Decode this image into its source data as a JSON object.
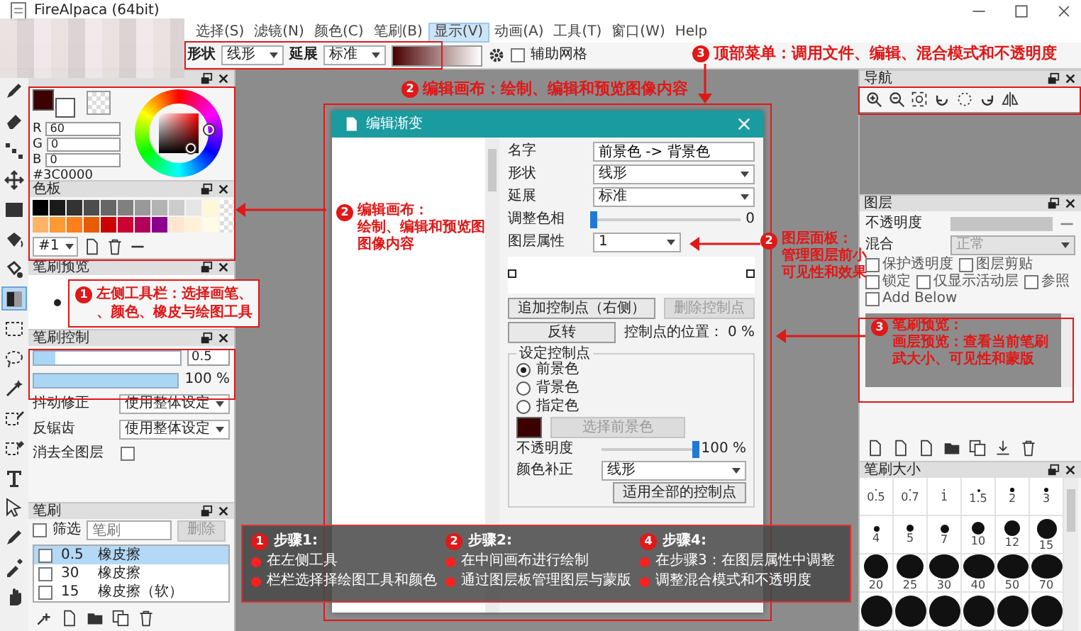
{
  "window": {
    "title": "FireAlpaca (64bit)"
  },
  "menu": [
    {
      "label": "选择(S)",
      "selected": false
    },
    {
      "label": "滤镜(N)",
      "selected": false
    },
    {
      "label": "颜色(C)",
      "selected": false
    },
    {
      "label": "笔刷(B)",
      "selected": false
    },
    {
      "label": "显示(V)",
      "selected": true
    },
    {
      "label": "动画(A)",
      "selected": false
    },
    {
      "label": "工具(T)",
      "selected": false
    },
    {
      "label": "窗口(W)",
      "selected": false
    },
    {
      "label": "Help",
      "selected": false
    }
  ],
  "toolbar": {
    "fields": [
      {
        "label": "形状",
        "value": "线形"
      },
      {
        "label": "延展",
        "value": "标准"
      }
    ],
    "grid": {
      "label": "辅助网格",
      "checked": false
    }
  },
  "tools": [
    {
      "kind": "pen",
      "selected": false
    },
    {
      "kind": "eraser",
      "selected": false
    },
    {
      "kind": "dots",
      "selected": false
    },
    {
      "kind": "move",
      "selected": false
    },
    {
      "kind": "rect",
      "selected": false
    },
    {
      "kind": "bucket",
      "selected": false
    },
    {
      "kind": "fill",
      "selected": false
    },
    {
      "kind": "gradient",
      "selected": true
    },
    {
      "kind": "select",
      "selected": false
    },
    {
      "kind": "lasso",
      "selected": false
    },
    {
      "kind": "wand",
      "selected": false
    },
    {
      "kind": "select-pen",
      "selected": false
    },
    {
      "kind": "select-eraser",
      "selected": false
    },
    {
      "kind": "text",
      "selected": false
    },
    {
      "kind": "pointer",
      "selected": false
    },
    {
      "kind": "pen",
      "selected": false
    },
    {
      "kind": "eyedropper",
      "selected": false
    },
    {
      "kind": "hand",
      "selected": false
    }
  ],
  "color_panel": {
    "foreground": {
      "color": "#3c0000"
    },
    "background": {
      "color": "#ffffff"
    },
    "channels": [
      {
        "label": "R",
        "value": "60"
      },
      {
        "label": "G",
        "value": "0"
      },
      {
        "label": "B",
        "value": "0"
      }
    ],
    "hex": "#3C0000"
  },
  "palette": {
    "title": "色板",
    "colors": [
      {
        "color": "#000000"
      },
      {
        "color": "#1a1a1a"
      },
      {
        "color": "#333333"
      },
      {
        "color": "#4d4d4d"
      },
      {
        "color": "#666666"
      },
      {
        "color": "#808080"
      },
      {
        "color": "#999999"
      },
      {
        "color": "#b3b3b3"
      },
      {
        "color": "#cccccc"
      },
      {
        "color": "#e6e6e6"
      },
      {
        "color": "#fff8d6"
      },
      {
        "color": "#ffb366"
      },
      {
        "color": "#ff9933"
      },
      {
        "color": "#ff7f1a"
      },
      {
        "color": "#e65c00"
      },
      {
        "color": "#cc0000"
      },
      {
        "color": "#cc0033"
      },
      {
        "color": "#b3005a"
      },
      {
        "color": "#8c008c"
      },
      {
        "color": "#ffe6cc"
      },
      {
        "color": "#fff2d9"
      },
      {
        "color": "#fffbe6"
      }
    ],
    "select": "#1"
  },
  "brush_preview": {
    "title": "笔刷预览"
  },
  "brush_control": {
    "title": "笔刷控制",
    "size": {
      "level": 0.15,
      "value": "0.5"
    },
    "opacity": {
      "level": 1,
      "value": "100 %"
    },
    "settings": [
      {
        "label": "抖动修正",
        "value": "使用整体设定"
      },
      {
        "label": "反锯齿",
        "value": "使用整体设定"
      }
    ],
    "erase_all": {
      "label": "消去全图层",
      "checked": false
    }
  },
  "brushes": {
    "title": "笔刷",
    "filter": {
      "label": "筛选",
      "checked": false
    },
    "search": {
      "placeholder": "笔刷"
    },
    "delete": "删除",
    "items": [
      {
        "size": "0.5",
        "name": "橡皮擦",
        "selected": true,
        "checked": false
      },
      {
        "size": "30",
        "name": "橡皮擦",
        "selected": false,
        "checked": false
      },
      {
        "size": "15",
        "name": "橡皮擦（软）",
        "selected": false,
        "checked": false
      }
    ]
  },
  "dialog": {
    "title": "编辑渐变",
    "name": {
      "label": "名字",
      "value": "前景色 -> 背景色"
    },
    "selects": [
      {
        "label": "形状",
        "value": "线形"
      },
      {
        "label": "延展",
        "value": "标准"
      }
    ],
    "hue": {
      "label": "调整色相",
      "level": 0,
      "value": "0"
    },
    "layer": {
      "label": "图层属性",
      "value": "1"
    },
    "add_button": {
      "label": "追加控制点（右侧）",
      "disabled": false
    },
    "remove_button": {
      "label": "删除控制点",
      "disabled": true
    },
    "reverse": "反转",
    "position": "控制点的位置： 0 %",
    "group": {
      "title": "设定控制点",
      "radios": [
        {
          "label": "前景色",
          "selected": true
        },
        {
          "label": "背景色",
          "selected": false
        },
        {
          "label": "指定色",
          "selected": false
        }
      ],
      "swatch": {
        "color": "#3c0000"
      },
      "pick_button": {
        "label": "选择前景色",
        "disabled": true
      },
      "opacity": {
        "label": "不透明度",
        "level": 1,
        "value": "100 %"
      },
      "correction": {
        "label": "颜色补正",
        "value": "线形"
      },
      "apply": "适用全部的控制点"
    }
  },
  "navigator": {
    "title": "导航"
  },
  "layers": {
    "title": "图层",
    "opacity": {
      "label": "不透明度",
      "disabled": true
    },
    "blend": {
      "label": "混合",
      "value": "正常",
      "disabled": true
    },
    "options": [
      {
        "label": "保护透明度",
        "checked": false
      },
      {
        "label": "图层剪贴",
        "checked": false
      },
      {
        "label": "锁定",
        "checked": false
      },
      {
        "label": "仅显示活动层",
        "checked": false
      },
      {
        "label": "参照",
        "checked": false
      },
      {
        "label": "Add Below",
        "checked": false
      }
    ]
  },
  "brush_size": {
    "title": "笔刷大小",
    "sizes": [
      "0.5",
      "0.7",
      "1",
      "1.5",
      "2",
      "3",
      "4",
      "5",
      "7",
      "10",
      "12",
      "15",
      "20",
      "25",
      "30",
      "40",
      "50",
      "70"
    ]
  },
  "annotations": [
    {
      "kind": "top-menu",
      "num": "3",
      "lines": [
        "顶部菜单：调用文件、编辑、混合模式和不透明度"
      ]
    },
    {
      "kind": "canvas-title",
      "num": "2",
      "lines": [
        "编辑画布：绘制、编辑和预览图像内容"
      ]
    },
    {
      "kind": "canvas-side",
      "num": "2",
      "lines": [
        "编辑画布：",
        "绘制、编辑和预览图",
        "图像内容"
      ]
    },
    {
      "kind": "toolbar-left",
      "num": "1",
      "lines": [
        "左侧工具栏：选择画笔、",
        "、颜色、橡皮与绘图工具"
      ]
    },
    {
      "kind": "layers",
      "num": "2",
      "lines": [
        "图层面板：",
        "管理图层前小",
        "可见性和效果"
      ]
    },
    {
      "kind": "brush-preview",
      "num": "3",
      "lines": [
        "笔刷预览：",
        "画层预览：查看当前笔刷",
        "武大小、可见性和蒙版"
      ]
    }
  ],
  "steps": [
    {
      "num": "1",
      "title": "步骤1:",
      "bullets": [
        "在左侧工具",
        "栏栏选择择绘图工具和颜色"
      ]
    },
    {
      "num": "2",
      "title": "步骤2:",
      "bullets": [
        "在中间画布进行绘制",
        "通过图层板管理图层与蒙版"
      ]
    },
    {
      "num": "4",
      "title": "步骤4:",
      "bullets": [
        "在步骤3：在图层属性中调整",
        "调整混合模式和不透明度"
      ]
    }
  ]
}
